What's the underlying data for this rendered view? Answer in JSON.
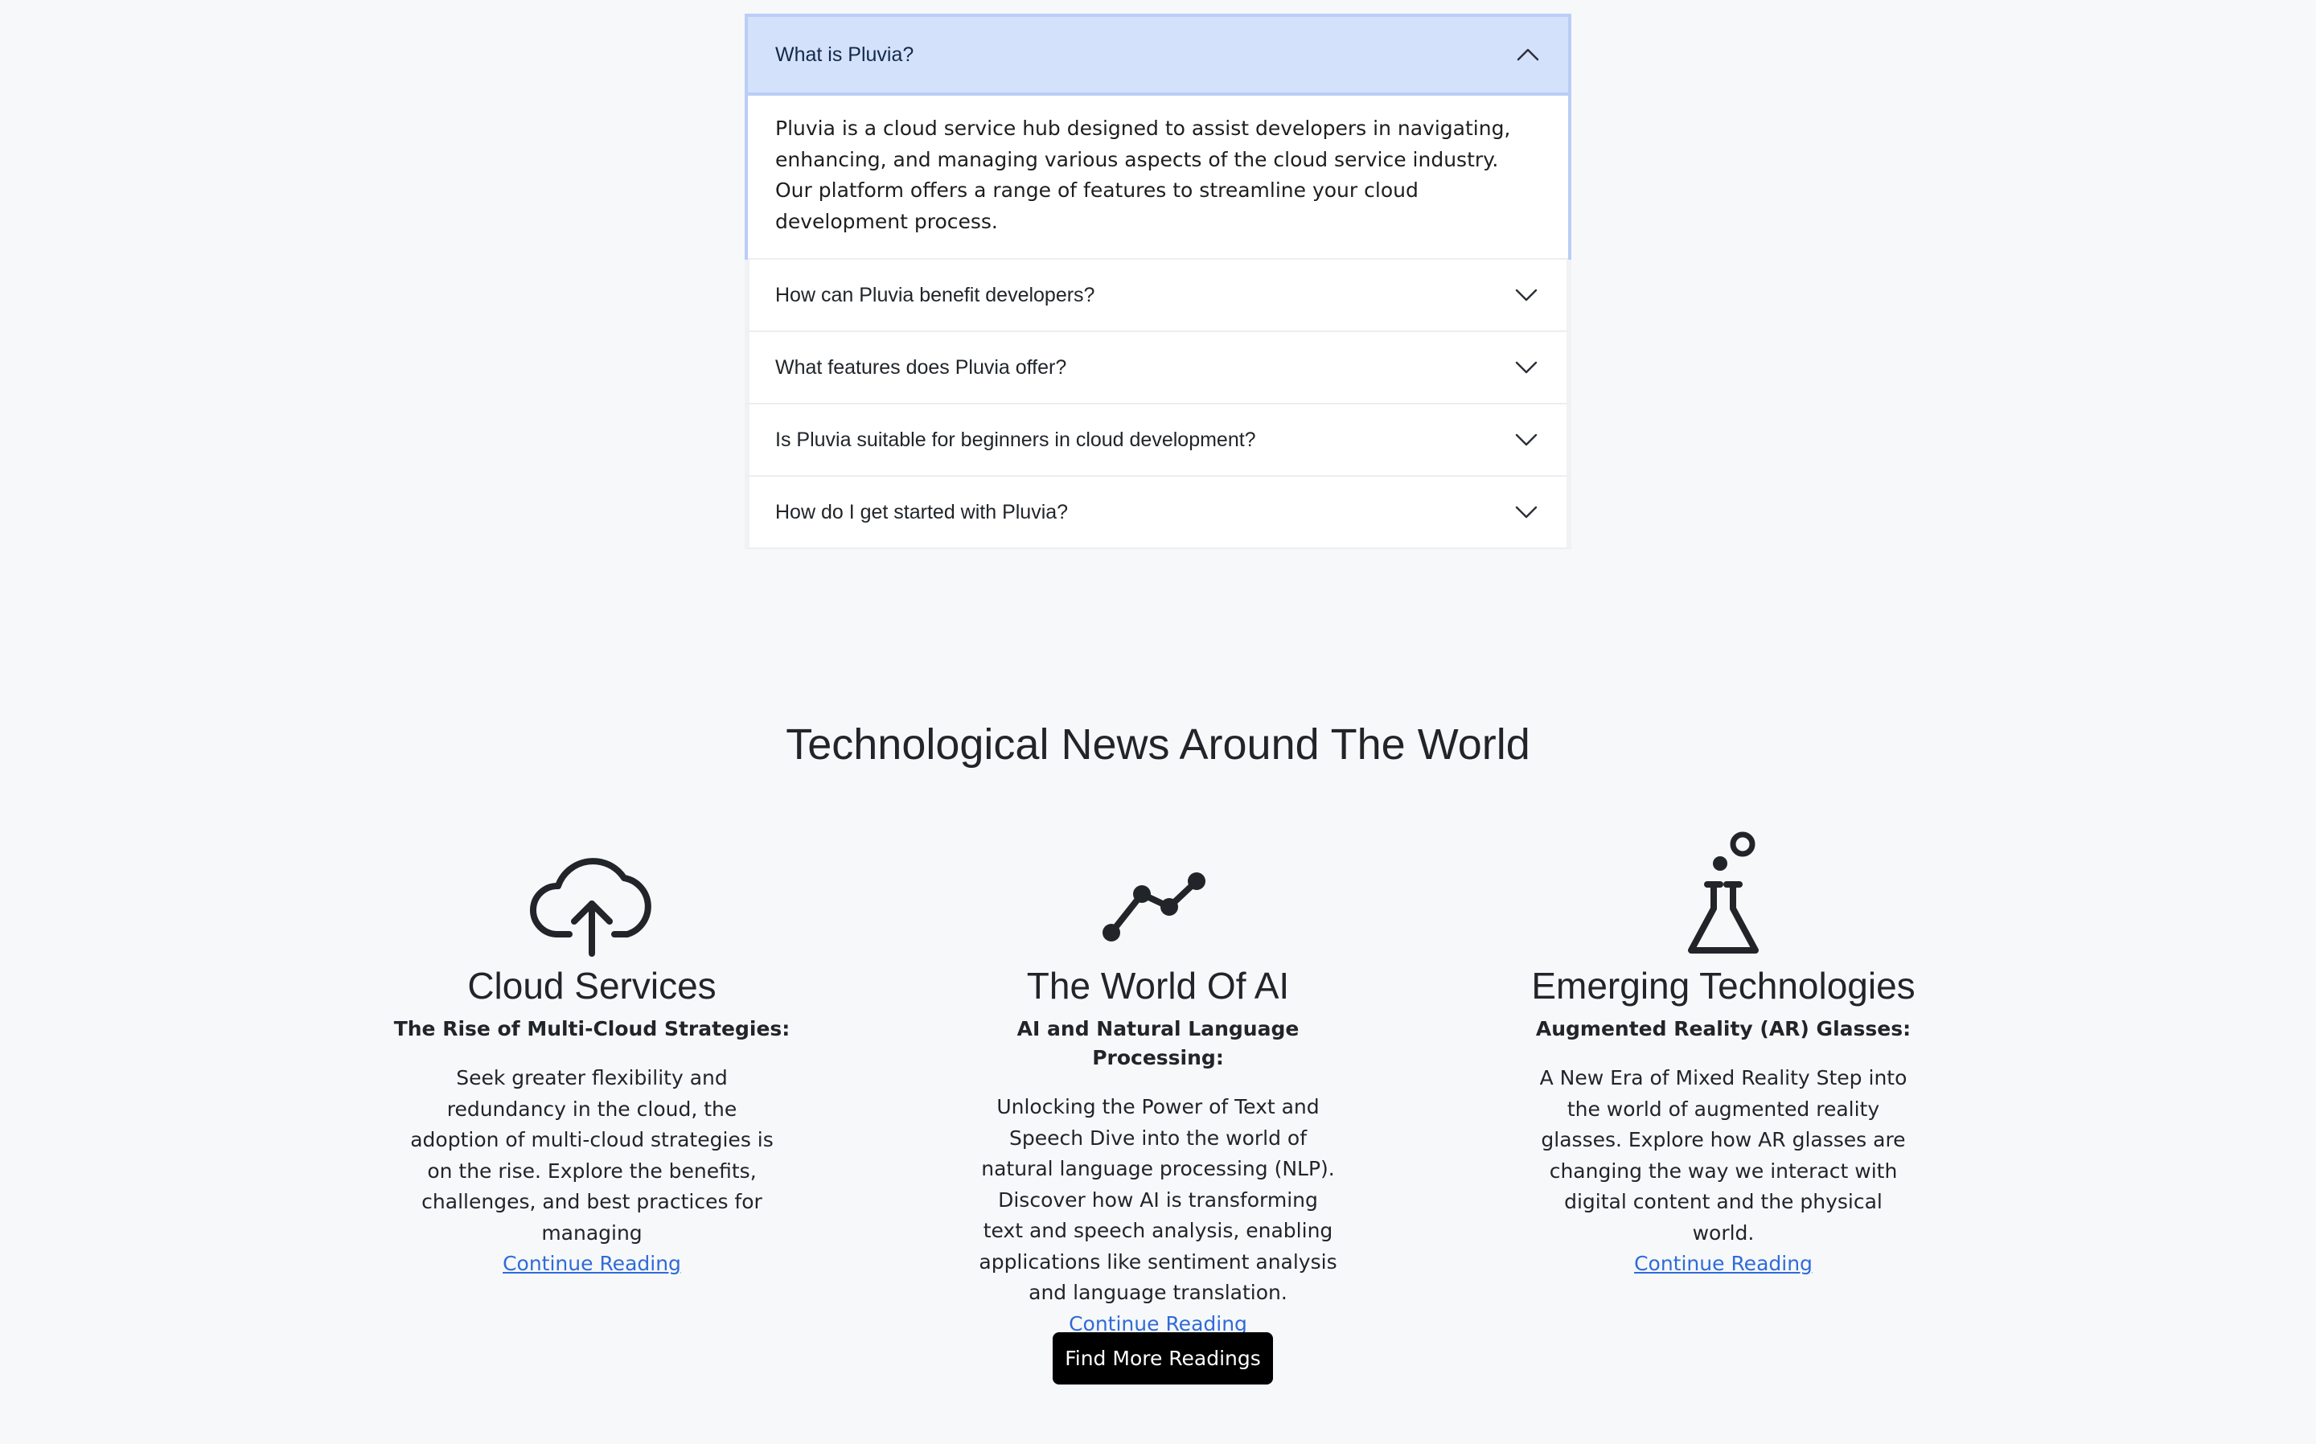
{
  "faq": {
    "items": [
      {
        "question": "What is Pluvia?",
        "answer": "Pluvia is a cloud service hub designed to assist developers in navigating, enhancing, and managing various aspects of the cloud service industry. Our platform offers a range of features to streamline your cloud development process.",
        "expanded": true,
        "chevron_icon": "chevron-up-icon"
      },
      {
        "question": "How can Pluvia benefit developers?",
        "expanded": false,
        "chevron_icon": "chevron-down-icon"
      },
      {
        "question": "What features does Pluvia offer?",
        "expanded": false,
        "chevron_icon": "chevron-down-icon"
      },
      {
        "question": "Is Pluvia suitable for beginners in cloud development?",
        "expanded": false,
        "chevron_icon": "chevron-down-icon"
      },
      {
        "question": "How do I get started with Pluvia?",
        "expanded": false,
        "chevron_icon": "chevron-down-icon"
      }
    ],
    "active_color": "#d3e1fb"
  },
  "news": {
    "title": "Technological News Around The World",
    "columns": [
      {
        "icon": "cloud-upload-icon",
        "heading": "Cloud Services",
        "subheading": "The Rise of Multi-Cloud Strategies:",
        "description": "Seek greater flexibility and redundancy in the cloud, the adoption of multi-cloud strategies is on the rise. Explore the benefits, challenges, and best practices for managing",
        "link": "Continue Reading"
      },
      {
        "icon": "line-chart-icon",
        "heading": "The World Of AI",
        "subheading": "AI and Natural Language Processing:",
        "description": "Unlocking the Power of Text and Speech Dive into the world of natural language processing (NLP). Discover how AI is transforming text and speech analysis, enabling applications like sentiment analysis and language translation.",
        "link": "Continue Reading"
      },
      {
        "icon": "flask-icon",
        "heading": "Emerging Technologies",
        "subheading": "Augmented Reality (AR) Glasses:",
        "description": "A New Era of Mixed Reality Step into the world of augmented reality glasses. Explore how AR glasses are changing the way we interact with digital content and the physical world.",
        "link": "Continue Reading"
      }
    ],
    "button_label": "Find More Readings",
    "link_color": "#2f6bd9"
  }
}
